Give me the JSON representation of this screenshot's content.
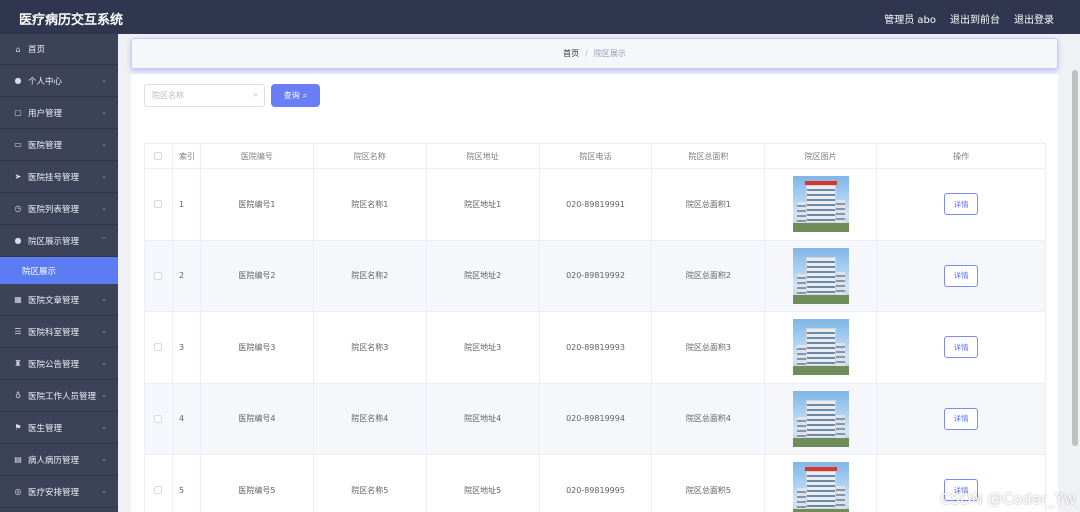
{
  "header": {
    "app_title": "医疗病历交互系统",
    "admin_label": "管理员 abo",
    "to_front": "退出到前台",
    "logout": "退出登录"
  },
  "sidebar": {
    "items": [
      {
        "label": "首页",
        "icon": "home-icon"
      },
      {
        "label": "个人中心",
        "icon": "user-icon"
      },
      {
        "label": "用户管理",
        "icon": "copy-icon"
      },
      {
        "label": "医院管理",
        "icon": "chat-icon"
      },
      {
        "label": "医院挂号管理",
        "icon": "send-icon"
      },
      {
        "label": "医院列表管理",
        "icon": "clock-icon"
      },
      {
        "label": "院区展示管理",
        "icon": "user-icon"
      },
      {
        "label": "医院文章管理",
        "icon": "grid-icon"
      },
      {
        "label": "医院科室管理",
        "icon": "sliders-icon"
      },
      {
        "label": "医院公告管理",
        "icon": "trophy-icon"
      },
      {
        "label": "医院工作人员管理",
        "icon": "mic-icon"
      },
      {
        "label": "医生管理",
        "icon": "flag-icon"
      },
      {
        "label": "病人病历管理",
        "icon": "list-icon"
      },
      {
        "label": "医疗安排管理",
        "icon": "compass-icon"
      }
    ],
    "active_sub": "院区展示"
  },
  "breadcrumb": {
    "home": "首页",
    "separator": "/",
    "current": "院区展示"
  },
  "search": {
    "placeholder": "院区名称",
    "button_label": "查询"
  },
  "table": {
    "headers": [
      "索引",
      "医院编号",
      "院区名称",
      "院区地址",
      "院区电话",
      "院区总面积",
      "院区图片",
      "操作"
    ],
    "rows": [
      {
        "index": "1",
        "code": "医院编号1",
        "name": "院区名称1",
        "address": "院区地址1",
        "phone": "020-89819991",
        "area": "院区总面积1",
        "action": "详情"
      },
      {
        "index": "2",
        "code": "医院编号2",
        "name": "院区名称2",
        "address": "院区地址2",
        "phone": "020-89819992",
        "area": "院区总面积2",
        "action": "详情"
      },
      {
        "index": "3",
        "code": "医院编号3",
        "name": "院区名称3",
        "address": "院区地址3",
        "phone": "020-89819993",
        "area": "院区总面积3",
        "action": "详情"
      },
      {
        "index": "4",
        "code": "医院编号4",
        "name": "院区名称4",
        "address": "院区地址4",
        "phone": "020-89819994",
        "area": "院区总面积4",
        "action": "详情"
      },
      {
        "index": "5",
        "code": "医院编号5",
        "name": "院区名称5",
        "address": "院区地址5",
        "phone": "020-89819995",
        "area": "院区总面积5",
        "action": "详情"
      }
    ]
  },
  "watermark": "CSDN @Coder_Yw",
  "colors": {
    "topbar": "#30364f",
    "sidebar": "#3c4359",
    "accent": "#5b7cf2",
    "query_button": "#6a7ff5"
  }
}
